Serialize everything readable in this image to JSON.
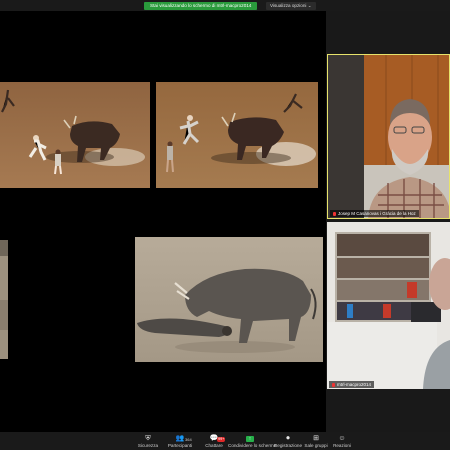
{
  "top_bar": {
    "share_banner": "Stai visualizzando lo schermo di mtrl-macpro2014",
    "view_options": "Visualizza opzioni ⌄"
  },
  "participants": [
    {
      "name": "Josep M Casanovas i Gràcia de la Hoz",
      "muted": true
    },
    {
      "name": "mtrl-macpro2014",
      "muted": true
    }
  ],
  "toolbar": {
    "items": [
      {
        "label": "Sicurezza",
        "icon": "shield-icon",
        "glyph": "⛨"
      },
      {
        "label": "Partecipanti",
        "icon": "participants-icon",
        "glyph": "👥",
        "count": "364"
      },
      {
        "label": "Chattare",
        "icon": "chat-icon",
        "glyph": "💬",
        "badge": "99+"
      },
      {
        "label": "Condividere lo schermo",
        "icon": "share-screen-icon",
        "glyph": "↑"
      },
      {
        "label": "Registrazione",
        "icon": "record-icon",
        "glyph": "⏺"
      },
      {
        "label": "Sale gruppi",
        "icon": "breakout-rooms-icon",
        "glyph": "⊞"
      },
      {
        "label": "Reazioni",
        "icon": "reactions-icon",
        "glyph": "☺"
      }
    ]
  },
  "colors": {
    "speaker_highlight": "#e7e36b",
    "share_green": "#2a9b3c",
    "mute_red": "#e33333"
  }
}
